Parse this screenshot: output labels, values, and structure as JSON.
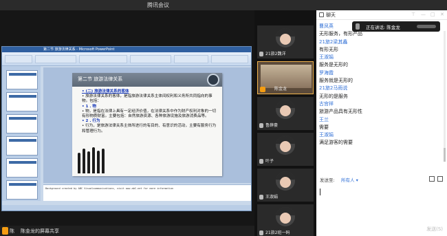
{
  "window": {
    "title": "腾讯会议"
  },
  "share": {
    "user": "陈",
    "label": "陈金龙的屏幕共享"
  },
  "ppt": {
    "app_title": "第二节 旅游法律关系 - Microsoft PowerPoint",
    "slide_heading": "第二节 旅游法律关系",
    "slide_lines": [
      {
        "kind": "sec",
        "text": "• (二) 旅游法律关系的客体"
      },
      {
        "kind": "body",
        "text": "• 旅游法律关系的客体，是指旅游法律关系主体间权利和义务所共同指向的事物。包括："
      },
      {
        "kind": "pt",
        "text": "• 1 . 物"
      },
      {
        "kind": "body",
        "text": "• 物，是指在法律上具有一定经济价值，在法律关系中作为财产权利对象的一切有形物质财富。主要包括：自然旅游资源、各种旅游设施及旅游消费品等。"
      },
      {
        "kind": "pt",
        "text": "• 2 . 行为"
      },
      {
        "kind": "body",
        "text": "• 行为，是旅游法律关系主体所进行的有目的、有意识的活动，主要有服务行为和管理行为。"
      }
    ],
    "notes": "Background created by ABC Visualcommunications, visit www.abC.net for more information"
  },
  "videos": [
    {
      "name": "21旅2魏洋",
      "active": false
    },
    {
      "name": "陈金龙",
      "active": true
    },
    {
      "name": "鲁薛豪",
      "active": false
    },
    {
      "name": "叶子",
      "active": false
    },
    {
      "name": "王淑娟",
      "active": false
    },
    {
      "name": "21旅2班一码",
      "active": false
    }
  ],
  "chat": {
    "title": "聊天",
    "speaking": "正在讲话: 陈金龙",
    "messages": [
      {
        "kind": "name",
        "text": "曹凤英"
      },
      {
        "kind": "text",
        "text": "无形服务，有形产品"
      },
      {
        "kind": "name",
        "text": "21旅2梁其鑫"
      },
      {
        "kind": "text",
        "text": "有形无形"
      },
      {
        "kind": "name",
        "text": "王淑娟"
      },
      {
        "kind": "text",
        "text": "服务是无形的"
      },
      {
        "kind": "name",
        "text": "罗海霞"
      },
      {
        "kind": "text",
        "text": "服务就是无形的"
      },
      {
        "kind": "name",
        "text": "21旅2马雨说"
      },
      {
        "kind": "text",
        "text": "无形的是服务"
      },
      {
        "kind": "name",
        "text": "古宫祥"
      },
      {
        "kind": "text",
        "text": "旅游产品具有无形性"
      },
      {
        "kind": "name",
        "text": "王兰"
      },
      {
        "kind": "text",
        "text": "需要"
      },
      {
        "kind": "name",
        "text": "王淑娟"
      },
      {
        "kind": "text",
        "text": "满足游客的需要"
      }
    ],
    "send_to_label": "发送至:",
    "send_to_value": "所有人 ▾",
    "send_button": "发送(S)"
  }
}
